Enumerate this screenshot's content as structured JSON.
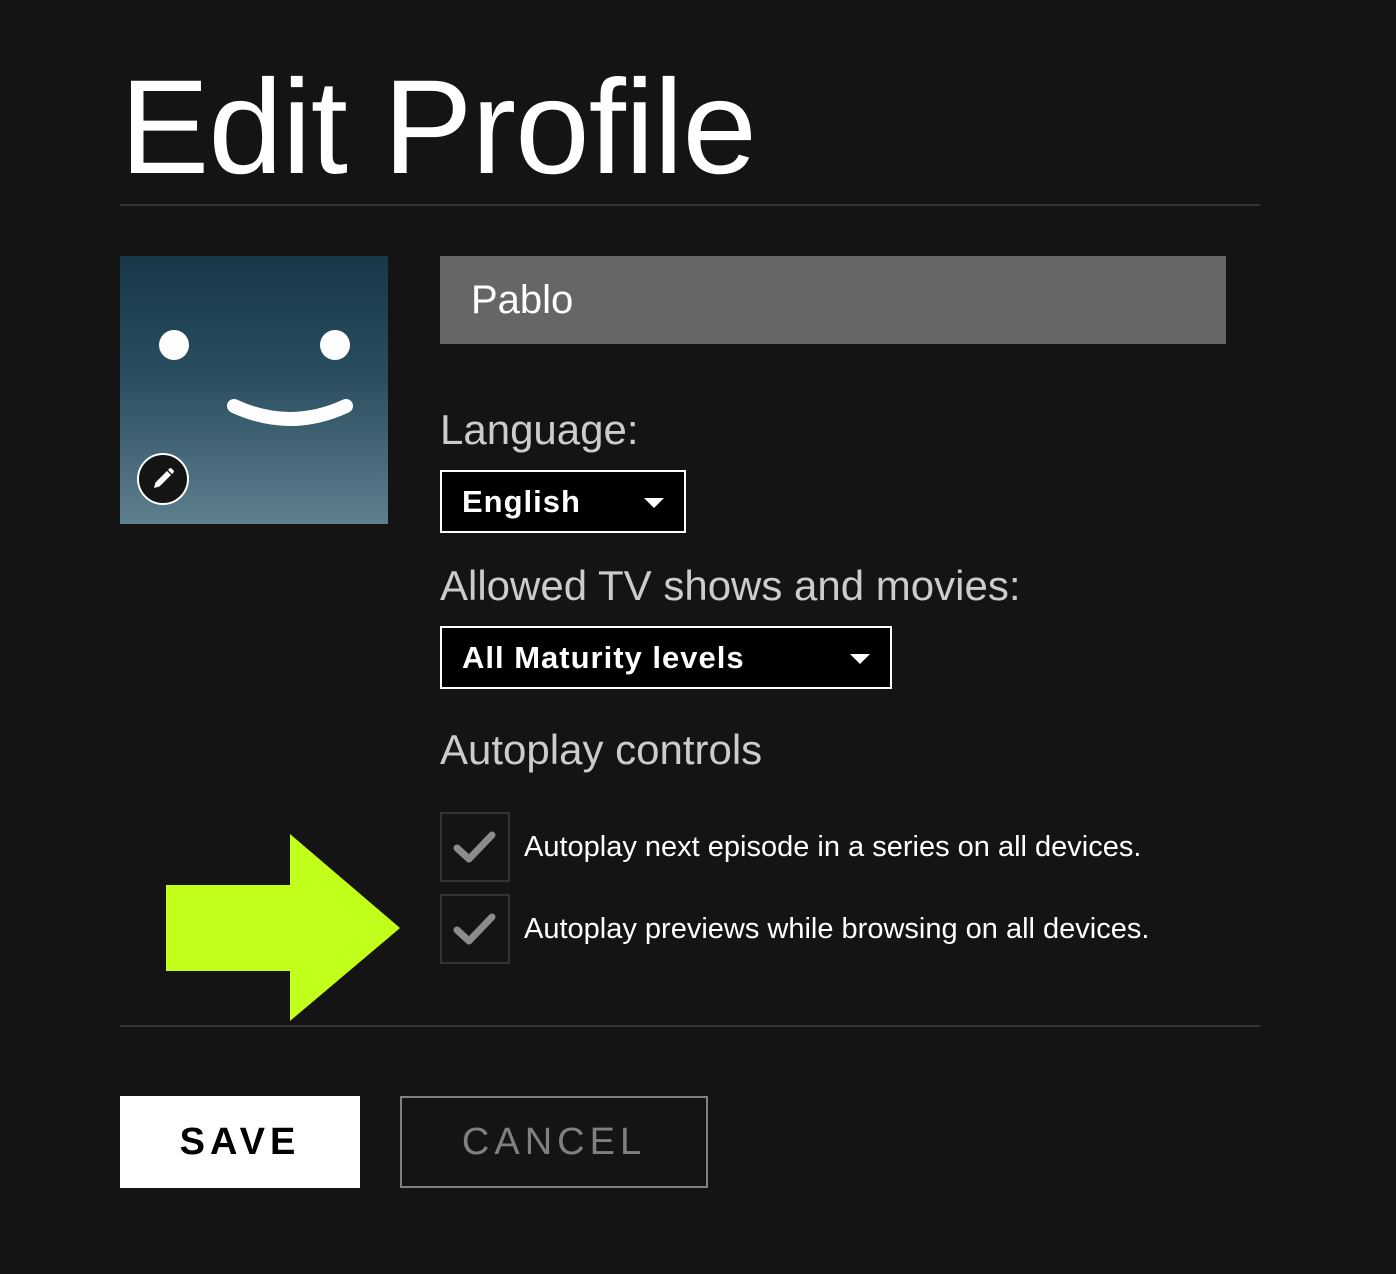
{
  "page": {
    "title": "Edit Profile"
  },
  "profile": {
    "name_value": "Pablo",
    "avatar_icon": "smiley-face-avatar",
    "edit_icon": "pencil-icon"
  },
  "language": {
    "label": "Language:",
    "selected": "English",
    "arrow_icon": "caret-down-icon"
  },
  "maturity": {
    "label": "Allowed TV shows and movies:",
    "selected": "All Maturity levels",
    "arrow_icon": "caret-down-icon"
  },
  "autoplay": {
    "heading": "Autoplay controls",
    "options": [
      {
        "label": "Autoplay next episode in a series on all devices.",
        "checked": true
      },
      {
        "label": "Autoplay previews while browsing on all devices.",
        "checked": true
      }
    ]
  },
  "annotation": {
    "arrow_color": "#c2ff1a",
    "points_to": "autoplay-previews-checkbox"
  },
  "actions": {
    "save_label": "SAVE",
    "cancel_label": "CANCEL"
  },
  "colors": {
    "background": "#141414",
    "input_bg": "#666666",
    "label_gray": "#cccccc",
    "cancel_gray": "#808080"
  }
}
